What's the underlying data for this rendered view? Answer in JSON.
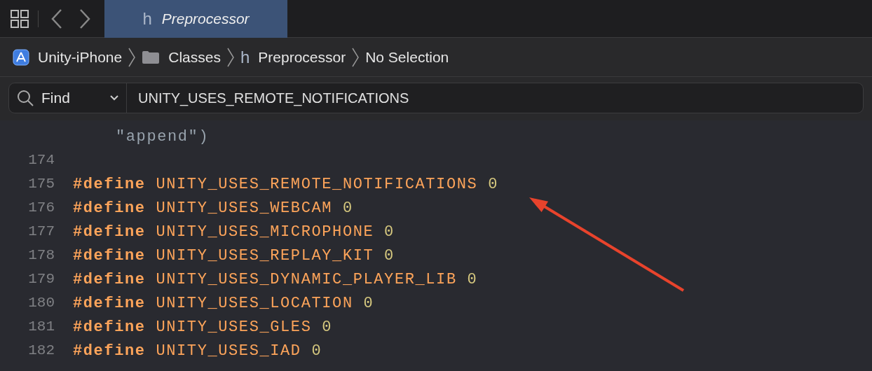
{
  "tabs": [
    {
      "icon": "h",
      "label": "Preprocessor",
      "selected": true
    }
  ],
  "breadcrumb": [
    {
      "kind": "project",
      "label": "Unity-iPhone"
    },
    {
      "kind": "folder",
      "label": "Classes"
    },
    {
      "kind": "header",
      "icon": "h",
      "label": "Preprocessor"
    },
    {
      "kind": "plain",
      "label": "No Selection"
    }
  ],
  "find": {
    "mode": "Find",
    "value": "UNITY_USES_REMOTE_NOTIFICATIONS"
  },
  "code": [
    {
      "kind": "continuation",
      "text": "\"append\")"
    },
    {
      "kind": "blank",
      "number": "174"
    },
    {
      "kind": "define",
      "number": "175",
      "directive": "#define",
      "name": "UNITY_USES_REMOTE_NOTIFICATIONS",
      "value": "0"
    },
    {
      "kind": "define",
      "number": "176",
      "directive": "#define",
      "name": "UNITY_USES_WEBCAM",
      "value": "0"
    },
    {
      "kind": "define",
      "number": "177",
      "directive": "#define",
      "name": "UNITY_USES_MICROPHONE",
      "value": "0"
    },
    {
      "kind": "define",
      "number": "178",
      "directive": "#define",
      "name": "UNITY_USES_REPLAY_KIT",
      "value": "0"
    },
    {
      "kind": "define",
      "number": "179",
      "directive": "#define",
      "name": "UNITY_USES_DYNAMIC_PLAYER_LIB",
      "value": "0"
    },
    {
      "kind": "define",
      "number": "180",
      "directive": "#define",
      "name": "UNITY_USES_LOCATION",
      "value": "0"
    },
    {
      "kind": "define",
      "number": "181",
      "directive": "#define",
      "name": "UNITY_USES_GLES",
      "value": "0"
    },
    {
      "kind": "define",
      "number": "182",
      "directive": "#define",
      "name": "UNITY_USES_IAD",
      "value": "0"
    }
  ]
}
